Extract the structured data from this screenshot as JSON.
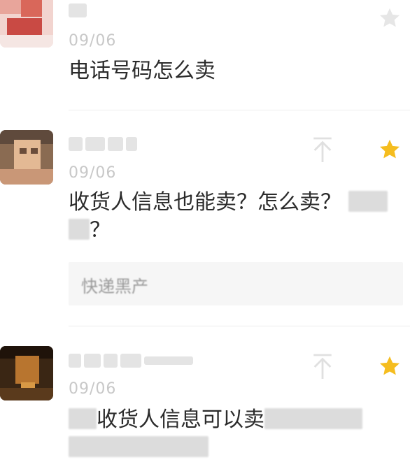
{
  "comments": [
    {
      "date": "09/06",
      "text": "电话号码怎么卖",
      "starred": false,
      "star_color": "#e6e6e6"
    },
    {
      "date": "09/06",
      "text": "收货人信息也能卖？怎么卖？",
      "text_suffix": "？",
      "starred": true,
      "star_color": "#f5bd1f",
      "reply": "快递黑产"
    },
    {
      "date": "09/06",
      "text": "收货人信息可以卖",
      "starred": true,
      "star_color": "#f5bd1f"
    }
  ]
}
